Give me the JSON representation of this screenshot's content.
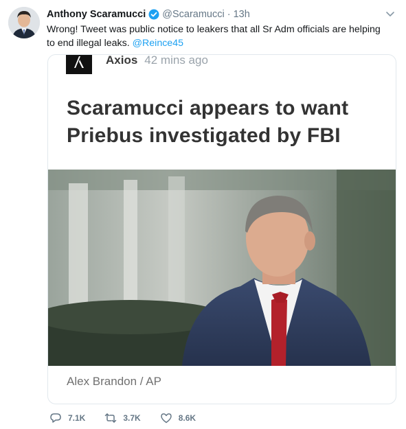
{
  "tweet": {
    "author_name": "Anthony Scaramucci",
    "handle": "@Scaramucci",
    "separator": "·",
    "time": "13h",
    "text": "Wrong! Tweet was public notice to leakers that all Sr Adm officials are helping to end illegal leaks.",
    "mention": "@Reince45",
    "icons": {
      "avatar": "author-avatar",
      "verified": "verified-badge-icon",
      "more": "chevron-down-icon"
    },
    "colors": {
      "link": "#1da1f2",
      "muted": "#657786",
      "text": "#14171a",
      "border": "#e1e8ed"
    }
  },
  "card": {
    "publisher": "Axios",
    "age": "42 mins ago",
    "headline": "Scaramucci appears to want Priebus investigated by FBI",
    "photo_credit": "Alex Brandon / AP",
    "logo_icon": "axios-logo"
  },
  "actions": {
    "reply_count": "7.1K",
    "retweet_count": "3.7K",
    "like_count": "8.6K",
    "icons": [
      "reply-icon",
      "retweet-icon",
      "like-icon"
    ]
  }
}
